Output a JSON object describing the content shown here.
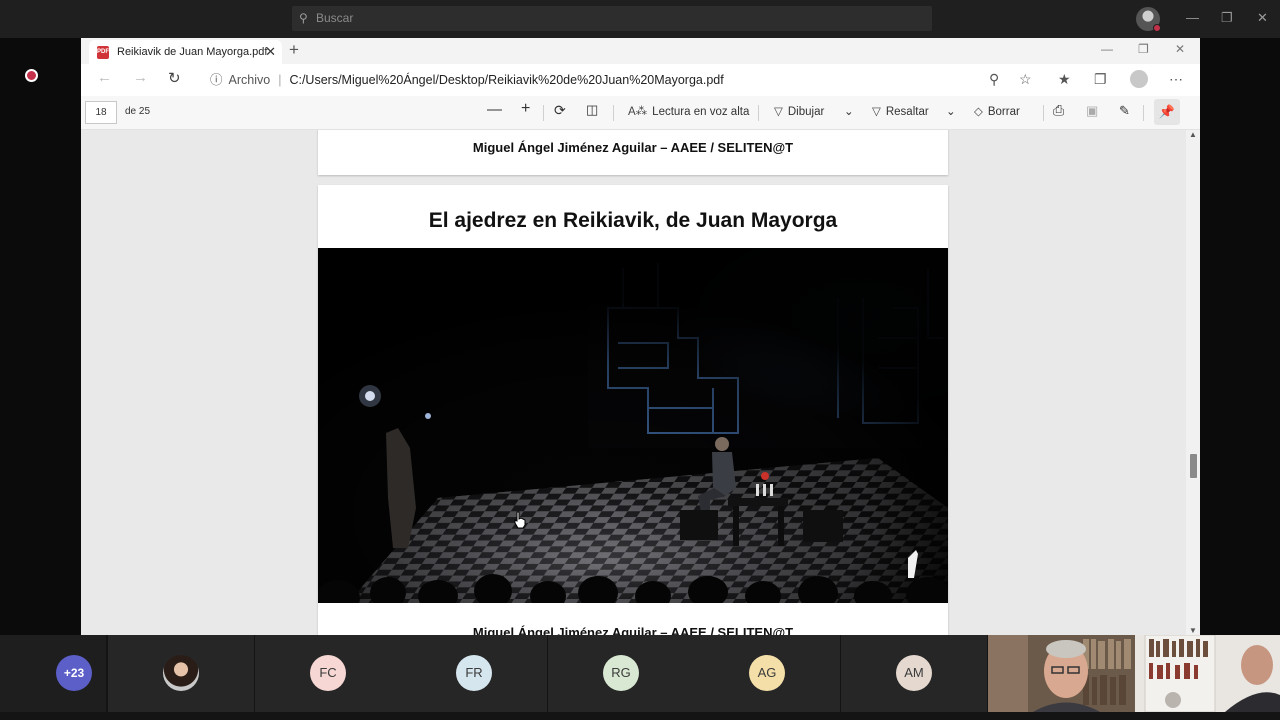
{
  "teams": {
    "search_placeholder": "Buscar",
    "participants": [
      {
        "initials": "+23",
        "color": "#5b5fc7"
      },
      {
        "initials": "",
        "color": "#cfcfcf"
      },
      {
        "initials": "FC",
        "color": "#f6d7d4"
      },
      {
        "initials": "FR",
        "color": "#d6e6ee"
      },
      {
        "initials": "RG",
        "color": "#d8e8d2"
      },
      {
        "initials": "AG",
        "color": "#f5dfa9"
      },
      {
        "initials": "AM",
        "color": "#e4d8cf"
      }
    ]
  },
  "browser": {
    "tab_title": "Reikiavik de Juan Mayorga.pdf",
    "address_label": "Archivo",
    "url": "C:/Users/Miguel%20Ángel/Desktop/Reikiavik%20de%20Juan%20Mayorga.pdf"
  },
  "pdf_toolbar": {
    "page_current": "18",
    "page_of": "de 25",
    "read_aloud": "Lectura en voz alta",
    "draw": "Dibujar",
    "highlight": "Resaltar",
    "erase": "Borrar"
  },
  "document": {
    "footer": "Miguel Ángel Jiménez Aguilar – AAEE / SELITEN@T",
    "slide_title": "El ajedrez en Reikiavik, de Juan Mayorga"
  },
  "colors": {
    "accent": "#5b5fc7",
    "record": "#c4314b",
    "pdf_icon": "#d13438"
  }
}
